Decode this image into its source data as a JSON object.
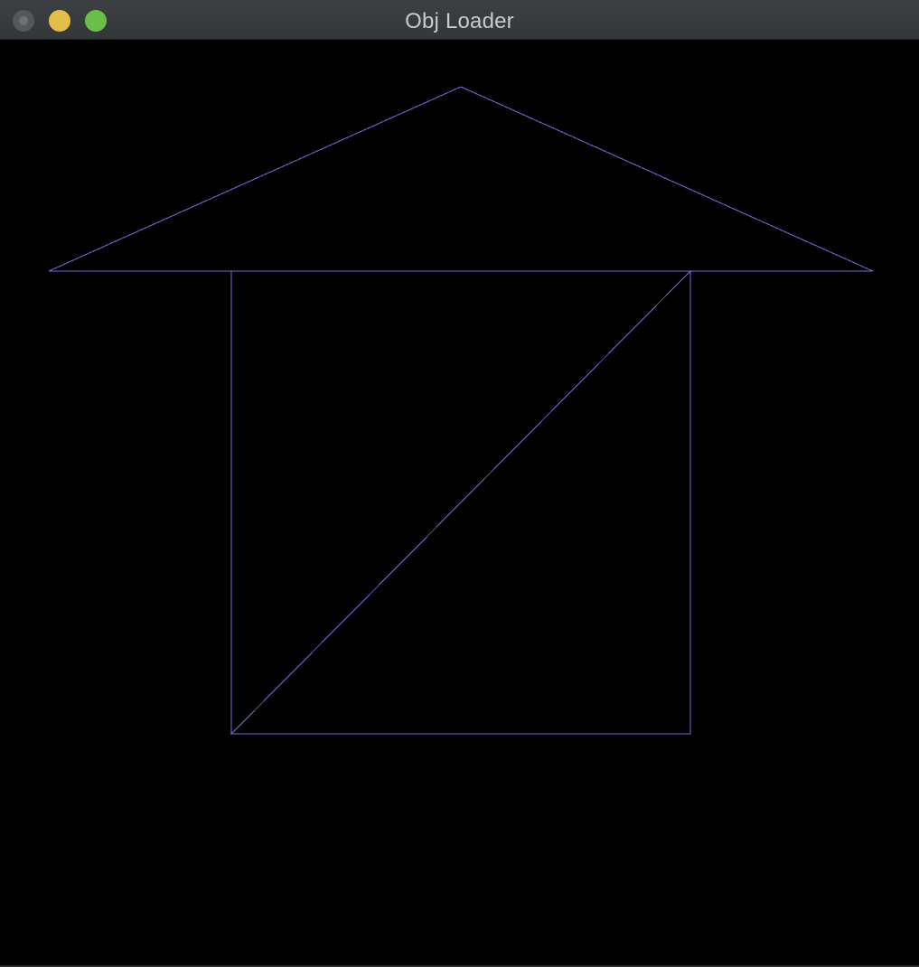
{
  "window": {
    "title": "Obj Loader"
  },
  "titlebar": {
    "buttons": [
      {
        "name": "close",
        "color": "#55585b"
      },
      {
        "name": "minimize",
        "color": "#e4bd4b"
      },
      {
        "name": "zoom",
        "color": "#6bbf48"
      }
    ]
  },
  "scene": {
    "background_color": "#000000",
    "wireframe_color": "#6f6fe0",
    "primitives": [
      "roof-triangle",
      "wall-triangle-upper",
      "wall-triangle-lower"
    ]
  }
}
